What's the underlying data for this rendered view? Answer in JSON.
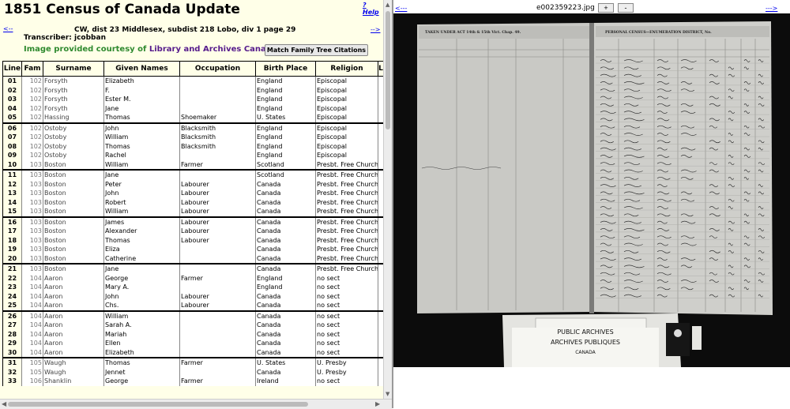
{
  "page": {
    "title": "1851 Census of Canada Update",
    "help_label": "? Help",
    "prev_link": "<--",
    "next_link": "-->",
    "location": "CW, dist 23 Middlesex, subdist 218 Lobo, div 1 page 29",
    "transcriber": "Transcriber: jcobban",
    "courtesy_prefix": "Image provided courtesy of ",
    "courtesy_link": "Library and Archives Canada",
    "courtesy_suffix": ".",
    "match_button": "Match Family Tree Citations"
  },
  "table": {
    "headers": [
      "Line",
      "Fam",
      "Surname",
      "Given Names",
      "Occupation",
      "Birth Place",
      "Religion",
      "L"
    ],
    "rows": [
      [
        "01",
        "102",
        "Forsyth",
        "Elizabeth",
        "",
        "England",
        "Episcopal"
      ],
      [
        "02",
        "102",
        "Forsyth",
        "F.",
        "",
        "England",
        "Episcopal"
      ],
      [
        "03",
        "102",
        "Forsyth",
        "Ester M.",
        "",
        "England",
        "Episcopal"
      ],
      [
        "04",
        "102",
        "Forsyth",
        "Jane",
        "",
        "England",
        "Episcopal"
      ],
      [
        "05",
        "102",
        "Hassing",
        "Thomas",
        "Shoemaker",
        "U. States",
        "Episcopal"
      ],
      [
        "06",
        "102",
        "Ostoby",
        "John",
        "Blacksmith",
        "England",
        "Episcopal"
      ],
      [
        "07",
        "102",
        "Ostoby",
        "William",
        "Blacksmith",
        "England",
        "Episcopal"
      ],
      [
        "08",
        "102",
        "Ostoby",
        "Thomas",
        "Blacksmith",
        "England",
        "Episcopal"
      ],
      [
        "09",
        "102",
        "Ostoby",
        "Rachel",
        "",
        "England",
        "Episcopal"
      ],
      [
        "10",
        "103",
        "Boston",
        "William",
        "Farmer",
        "Scotland",
        "Presbt. Free Church"
      ],
      [
        "11",
        "103",
        "Boston",
        "Jane",
        "",
        "Scotland",
        "Presbt. Free Church"
      ],
      [
        "12",
        "103",
        "Boston",
        "Peter",
        "Labourer",
        "Canada",
        "Presbt. Free Church"
      ],
      [
        "13",
        "103",
        "Boston",
        "John",
        "Labourer",
        "Canada",
        "Presbt. Free Church"
      ],
      [
        "14",
        "103",
        "Boston",
        "Robert",
        "Labourer",
        "Canada",
        "Presbt. Free Church"
      ],
      [
        "15",
        "103",
        "Boston",
        "William",
        "Labourer",
        "Canada",
        "Presbt. Free Church"
      ],
      [
        "16",
        "103",
        "Boston",
        "James",
        "Labourer",
        "Canada",
        "Presbt. Free Church"
      ],
      [
        "17",
        "103",
        "Boston",
        "Alexander",
        "Labourer",
        "Canada",
        "Presbt. Free Church"
      ],
      [
        "18",
        "103",
        "Boston",
        "Thomas",
        "Labourer",
        "Canada",
        "Presbt. Free Church"
      ],
      [
        "19",
        "103",
        "Boston",
        "Eliza",
        "",
        "Canada",
        "Presbt. Free Church"
      ],
      [
        "20",
        "103",
        "Boston",
        "Catherine",
        "",
        "Canada",
        "Presbt. Free Church"
      ],
      [
        "21",
        "103",
        "Boston",
        "Jane",
        "",
        "Canada",
        "Presbt. Free Church"
      ],
      [
        "22",
        "104",
        "Aaron",
        "George",
        "Farmer",
        "England",
        "no sect"
      ],
      [
        "23",
        "104",
        "Aaron",
        "Mary A.",
        "",
        "England",
        "no sect"
      ],
      [
        "24",
        "104",
        "Aaron",
        "John",
        "Labourer",
        "Canada",
        "no sect"
      ],
      [
        "25",
        "104",
        "Aaron",
        "Chs.",
        "Labourer",
        "Canada",
        "no sect"
      ],
      [
        "26",
        "104",
        "Aaron",
        "William",
        "",
        "Canada",
        "no sect"
      ],
      [
        "27",
        "104",
        "Aaron",
        "Sarah A.",
        "",
        "Canada",
        "no sect"
      ],
      [
        "28",
        "104",
        "Aaron",
        "Mariah",
        "",
        "Canada",
        "no sect"
      ],
      [
        "29",
        "104",
        "Aaron",
        "Ellen",
        "",
        "Canada",
        "no sect"
      ],
      [
        "30",
        "104",
        "Aaron",
        "Elizabeth",
        "",
        "Canada",
        "no sect"
      ],
      [
        "31",
        "105",
        "Waugh",
        "Thomas",
        "Farmer",
        "U. States",
        "U. Presby"
      ],
      [
        "32",
        "105",
        "Waugh",
        "Jennet",
        "",
        "Canada",
        "U. Presby"
      ],
      [
        "33",
        "106",
        "Shanklin",
        "George",
        "Farmer",
        "Ireland",
        "no sect"
      ]
    ]
  },
  "image_viewer": {
    "filename": "e002359223.jpg",
    "zoom_in": "+",
    "zoom_out": "-",
    "prev_link": "<---",
    "next_link": "--->",
    "left_header": "TAKEN UNDER ACT 14th & 15th Vict. Chap. 49.",
    "right_header": "PERSONAL CENSUS—ENUMERATION DISTRICT, No.",
    "stamp_line1": "PUBLIC ARCHIVES",
    "stamp_line2": "ARCHIVES PUBLIQUES",
    "stamp_line3": "CANADA"
  },
  "colors": {
    "panel_bg": "#ffffe8",
    "link": "#0000ee",
    "courtesy_green": "#2f8a2f"
  }
}
